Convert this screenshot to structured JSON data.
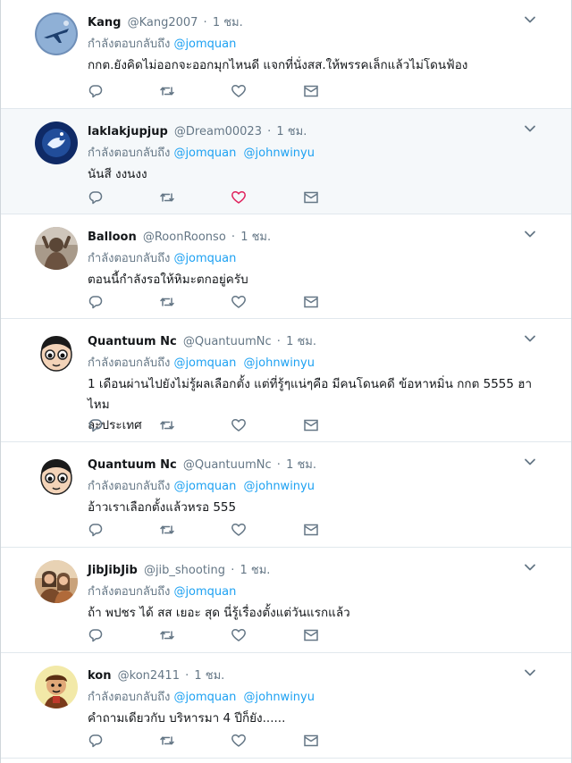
{
  "reply_prefix": "กำลังตอบกลับถึง",
  "colors": {
    "accent": "#1da1f2",
    "muted": "#657786",
    "liked": "#e0245e"
  },
  "tweets": [
    {
      "name": "Kang",
      "handle": "@Kang2007",
      "time": "1 ชม.",
      "mentions": [
        "@jomquan"
      ],
      "lines": [
        "กกต.ยังคิดไม่ออกจะออกมุกไหนดี แจกที่นั่งสส.ให้พรรคเล็กแล้วไม่โดนฟ้อง"
      ],
      "liked": false,
      "avatar_icon": "airplane-avatar"
    },
    {
      "name": "laklakjupjup",
      "handle": "@Dream00023",
      "time": "1 ชม.",
      "mentions": [
        "@jomquan",
        "@johnwinyu"
      ],
      "lines": [
        "นันสี งงนงง"
      ],
      "liked": true,
      "avatar_icon": "bird-avatar"
    },
    {
      "name": "Balloon",
      "handle": "@RoonRoonso",
      "time": "1 ชม.",
      "mentions": [
        "@jomquan"
      ],
      "lines": [
        "ตอนนี้กำลังรอให้หิมะตกอยู่ครับ"
      ],
      "liked": false,
      "avatar_icon": "person-avatar"
    },
    {
      "name": "Quantuum Nc",
      "handle": "@QuantuumNc",
      "time": "1 ชม.",
      "mentions": [
        "@jomquan",
        "@johnwinyu"
      ],
      "lines": [
        "1 เดือนผ่านไปยังไม่รู้ผลเลือกตั้ง แต่ที่รู้ๆแน่ๆคือ มีคนโดนคดี ข้อหาหมิ่น กกต 5555 ฮาไหม",
        "ละประเทศ"
      ],
      "liked": false,
      "avatar_icon": "cartoon-face-avatar"
    },
    {
      "name": "Quantuum Nc",
      "handle": "@QuantuumNc",
      "time": "1 ชม.",
      "mentions": [
        "@jomquan",
        "@johnwinyu"
      ],
      "lines": [
        "อ้าวเราเลือกตั้งแล้วหรอ 555"
      ],
      "liked": false,
      "avatar_icon": "cartoon-face-avatar"
    },
    {
      "name": "JibJibJib",
      "handle": "@jib_shooting",
      "time": "1 ชม.",
      "mentions": [
        "@jomquan"
      ],
      "lines": [
        "ถ้า พปชร ได้ สส เยอะ สุด นี่รู้เรื่องตั้งแต่วันแรกแล้ว"
      ],
      "liked": false,
      "avatar_icon": "couple-photo-avatar"
    },
    {
      "name": "kon",
      "handle": "@kon2411",
      "time": "1 ชม.",
      "mentions": [
        "@jomquan",
        "@johnwinyu"
      ],
      "lines": [
        "คำถามเดียวกับ บริหารมา 4 ปีก็ยัง......"
      ],
      "liked": false,
      "avatar_icon": "cartoon-figure-avatar"
    }
  ]
}
